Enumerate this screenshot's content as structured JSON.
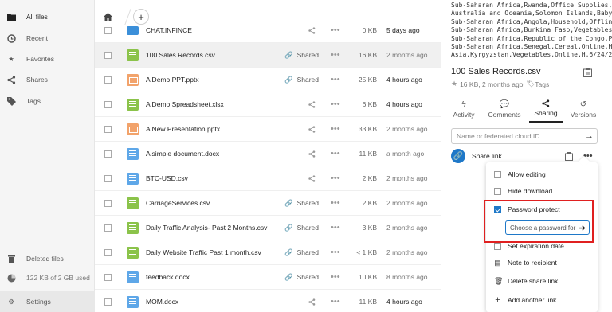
{
  "sidebar": {
    "items": [
      {
        "label": "All files",
        "icon": "folder-icon",
        "active": true
      },
      {
        "label": "Recent",
        "icon": "clock-icon"
      },
      {
        "label": "Favorites",
        "icon": "star-icon"
      },
      {
        "label": "Shares",
        "icon": "share-icon"
      },
      {
        "label": "Tags",
        "icon": "tag-icon"
      }
    ],
    "deleted_label": "Deleted files",
    "quota": "122 KB of 2 GB used",
    "settings_label": "Settings"
  },
  "breadcrumb": {
    "add_label": "+"
  },
  "files": [
    {
      "name": "CHAT.INFINCE",
      "type": "folder",
      "shared": "",
      "size": "0 KB",
      "modified": "5 days ago",
      "recent": true
    },
    {
      "name": "100 Sales Records.csv",
      "type": "sheet",
      "shared": "Shared",
      "size": "16 KB",
      "modified": "2 months ago",
      "recent": false,
      "selected": true
    },
    {
      "name": "A Demo PPT.pptx",
      "type": "slides",
      "shared": "Shared",
      "size": "25 KB",
      "modified": "4 hours ago",
      "recent": true
    },
    {
      "name": "A Demo Spreadsheet.xlsx",
      "type": "sheet",
      "shared": "",
      "size": "6 KB",
      "modified": "4 hours ago",
      "recent": true
    },
    {
      "name": "A New Presentation.pptx",
      "type": "slides",
      "shared": "",
      "size": "33 KB",
      "modified": "2 months ago",
      "recent": false
    },
    {
      "name": "A simple document.docx",
      "type": "doc",
      "shared": "",
      "size": "11 KB",
      "modified": "a month ago",
      "recent": false
    },
    {
      "name": "BTC-USD.csv",
      "type": "doc",
      "shared": "",
      "size": "2 KB",
      "modified": "2 months ago",
      "recent": false
    },
    {
      "name": "CarriageServices.csv",
      "type": "sheet",
      "shared": "Shared",
      "size": "2 KB",
      "modified": "2 months ago",
      "recent": false
    },
    {
      "name": "Daily Traffic Analysis- Past 2 Months.csv",
      "type": "sheet",
      "shared": "Shared",
      "size": "3 KB",
      "modified": "2 months ago",
      "recent": false
    },
    {
      "name": "Daily Website Traffic Past 1 month.csv",
      "type": "sheet",
      "shared": "Shared",
      "size": "< 1 KB",
      "modified": "2 months ago",
      "recent": false
    },
    {
      "name": "feedback.docx",
      "type": "doc",
      "shared": "Shared",
      "size": "10 KB",
      "modified": "8 months ago",
      "recent": false
    },
    {
      "name": "MOM.docx",
      "type": "doc",
      "shared": "",
      "size": "11 KB",
      "modified": "4 hours ago",
      "recent": true
    }
  ],
  "preview_lines": [
    "Sub-Saharan Africa,Rwanda,Office Supplies,O",
    "Australia and Oceania,Solomon Islands,Baby F",
    "Sub-Saharan Africa,Angola,Household,Offline,",
    "Sub-Saharan Africa,Burkina Faso,Vegetables,O",
    "Sub-Saharan Africa,Republic of the Congo,Per",
    "Sub-Saharan Africa,Senegal,Cereal,Online,H,4",
    "Asia,Kyrgyzstan,Vegetables,Online,H,6/24/201",
    "Sub-Saharan Africa,Cape Verde,Clothes,Offlin"
  ],
  "details": {
    "title": "100 Sales Records.csv",
    "meta": "16 KB, 2 months ago",
    "tags_label": "Tags",
    "tabs": [
      {
        "label": "Activity",
        "icon": "activity-icon"
      },
      {
        "label": "Comments",
        "icon": "comment-icon"
      },
      {
        "label": "Sharing",
        "icon": "share-icon",
        "active": true
      },
      {
        "label": "Versions",
        "icon": "history-icon"
      }
    ],
    "share_placeholder": "Name or federated cloud ID...",
    "share_link_label": "Share link"
  },
  "menu": {
    "allow_editing": "Allow editing",
    "hide_download": "Hide download",
    "password_protect": "Password protect",
    "password_placeholder": "Choose a password for",
    "set_expiration": "Set expiration date",
    "note": "Note to recipient",
    "delete_link": "Delete share link",
    "add_link": "Add another link"
  },
  "colors": {
    "accent": "#1e78c8",
    "highlight": "#e02020"
  }
}
